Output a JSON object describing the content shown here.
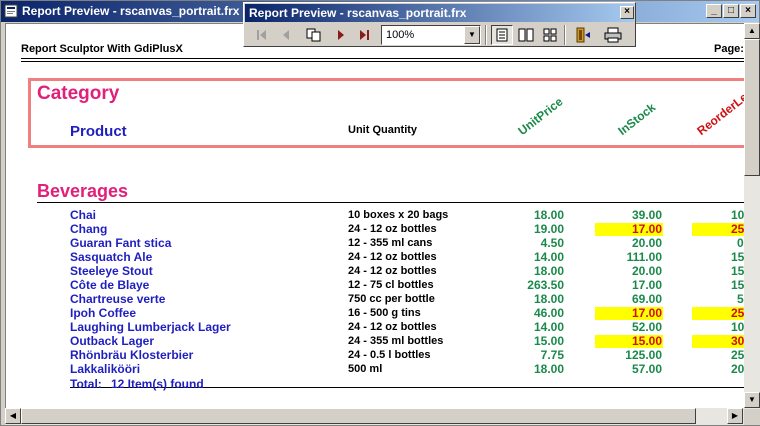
{
  "window": {
    "title": "Report Preview - rscanvas_portrait.frx",
    "minimize": "_",
    "maximize": "□",
    "close": "×"
  },
  "toolbar": {
    "title": "Report Preview - rscanvas_portrait.frx",
    "close": "×",
    "zoom_value": "100%",
    "zoom_arrow": "▼",
    "buttons": [
      "first-page",
      "previous-page",
      "copy",
      "next-page",
      "last-page",
      "one-page",
      "two-pages",
      "multiple-pages",
      "exit",
      "print"
    ]
  },
  "report": {
    "header_left": "Report Sculptor With GdiPlusX",
    "header_right": "Page:",
    "group_label": "Category",
    "detail_label": "Product",
    "col_qty": "Unit Quantity",
    "col_price": "UnitPrice",
    "col_stock": "InStock",
    "col_reorder": "ReorderLevel",
    "category": "Beverages",
    "rows": [
      {
        "name": "Chai",
        "qty": "10 boxes x 20 bags",
        "price": "18.00",
        "stock": "39.00",
        "reorder": "10",
        "low": false
      },
      {
        "name": "Chang",
        "qty": "24 - 12 oz bottles",
        "price": "19.00",
        "stock": "17.00",
        "reorder": "25",
        "low": true
      },
      {
        "name": "Guaran  Fant stica",
        "qty": "12 - 355 ml cans",
        "price": "4.50",
        "stock": "20.00",
        "reorder": "0",
        "low": false
      },
      {
        "name": "Sasquatch Ale",
        "qty": "24 - 12 oz bottles",
        "price": "14.00",
        "stock": "111.00",
        "reorder": "15",
        "low": false
      },
      {
        "name": "Steeleye Stout",
        "qty": "24 - 12 oz bottles",
        "price": "18.00",
        "stock": "20.00",
        "reorder": "15",
        "low": false
      },
      {
        "name": "Côte de Blaye",
        "qty": "12 - 75 cl bottles",
        "price": "263.50",
        "stock": "17.00",
        "reorder": "15",
        "low": false
      },
      {
        "name": "Chartreuse verte",
        "qty": "750 cc per bottle",
        "price": "18.00",
        "stock": "69.00",
        "reorder": "5",
        "low": false
      },
      {
        "name": "Ipoh Coffee",
        "qty": "16 - 500 g tins",
        "price": "46.00",
        "stock": "17.00",
        "reorder": "25",
        "low": true
      },
      {
        "name": "Laughing Lumberjack Lager",
        "qty": "24 - 12 oz bottles",
        "price": "14.00",
        "stock": "52.00",
        "reorder": "10",
        "low": false
      },
      {
        "name": "Outback Lager",
        "qty": "24 - 355 ml bottles",
        "price": "15.00",
        "stock": "15.00",
        "reorder": "30",
        "low": true
      },
      {
        "name": "Rhönbräu Klosterbier",
        "qty": "24 - 0.5 l bottles",
        "price": "7.75",
        "stock": "125.00",
        "reorder": "25",
        "low": false
      },
      {
        "name": "Lakkalikööri",
        "qty": "500 ml",
        "price": "18.00",
        "stock": "57.00",
        "reorder": "20",
        "low": false
      }
    ],
    "total_label": "Total:",
    "total_value": "12 Item(s) found"
  },
  "colors": {
    "category": "#e0207a",
    "product": "#1f1fbf",
    "value": "#1a8a4a",
    "alert": "#d01010",
    "highlight": "#ffff00",
    "frame": "#f08080"
  }
}
